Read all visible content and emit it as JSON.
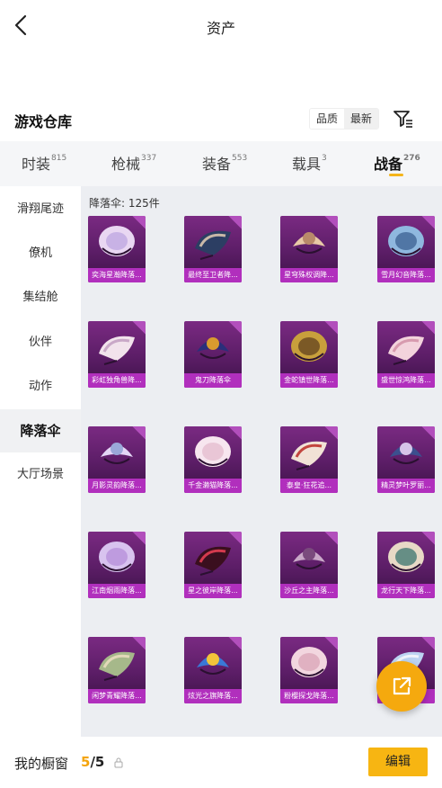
{
  "header": {
    "title": "资产"
  },
  "warehouse": {
    "title": "游戏仓库",
    "sort_options": [
      "品质",
      "最新"
    ],
    "selected_sort": "最新"
  },
  "tabs": [
    {
      "label": "时装",
      "count": "815",
      "active": false
    },
    {
      "label": "枪械",
      "count": "337",
      "active": false
    },
    {
      "label": "装备",
      "count": "553",
      "active": false
    },
    {
      "label": "载具",
      "count": "3",
      "active": false
    },
    {
      "label": "战备",
      "count": "276",
      "active": true
    }
  ],
  "sidebar": {
    "items": [
      {
        "label": "滑翔尾迹",
        "active": false
      },
      {
        "label": "僚机",
        "active": false
      },
      {
        "label": "集结舱",
        "active": false
      },
      {
        "label": "伙伴",
        "active": false
      },
      {
        "label": "动作",
        "active": false
      },
      {
        "label": "降落伞",
        "active": true
      },
      {
        "label": "大厅场景",
        "active": false
      }
    ]
  },
  "grid": {
    "count_text": "降落伞: 125件",
    "items": [
      {
        "label": "奕海星瀚降落...",
        "icon": "shell-parachute-icon"
      },
      {
        "label": "最终至卫者降...",
        "icon": "dark-wing-parachute-icon"
      },
      {
        "label": "星穹殊权调降...",
        "icon": "ornate-round-parachute-icon"
      },
      {
        "label": "雪月幻音降落...",
        "icon": "blue-wing-parachute-icon"
      },
      {
        "label": "彩虹独角兽降...",
        "icon": "fan-parachute-icon"
      },
      {
        "label": "鬼刀降落伞",
        "icon": "ghost-blade-parachute-icon"
      },
      {
        "label": "金蛇镇世降落...",
        "icon": "golden-snake-parachute-icon"
      },
      {
        "label": "盛世惊鸿降落...",
        "icon": "pink-lace-parachute-icon"
      },
      {
        "label": "月影灵韵降落...",
        "icon": "moon-fan-parachute-icon"
      },
      {
        "label": "千金濑猫降落...",
        "icon": "cat-parachute-icon"
      },
      {
        "label": "泰皇·狂花追...",
        "icon": "round-portrait-parachute-icon"
      },
      {
        "label": "精灵梦叶罗丽...",
        "icon": "fairy-fan-parachute-icon"
      },
      {
        "label": "江南烟雨降落...",
        "icon": "butterfly-parachute-icon"
      },
      {
        "label": "星之彼岸降落...",
        "icon": "red-flower-parachute-icon"
      },
      {
        "label": "沙丘之主降落...",
        "icon": "dune-parachute-icon"
      },
      {
        "label": "龙行天下降落...",
        "icon": "dragon-parachute-icon"
      },
      {
        "label": "闲梦青耀降落...",
        "icon": "jade-round-parachute-icon"
      },
      {
        "label": "炫光之旗降落...",
        "icon": "colorful-flag-parachute-icon"
      },
      {
        "label": "粉樱探戈降落...",
        "icon": "pink-sakura-parachute-icon"
      },
      {
        "label": "",
        "icon": "blue-fan-parachute-icon"
      }
    ]
  },
  "bottom": {
    "showcase_label": "我的橱窗",
    "showcase_current": "5",
    "showcase_total": "/5",
    "edit_label": "编辑"
  },
  "colors": {
    "accent": "#f5a90e",
    "card_purple": "#7a2a82",
    "card_label": "#b12fbd"
  }
}
